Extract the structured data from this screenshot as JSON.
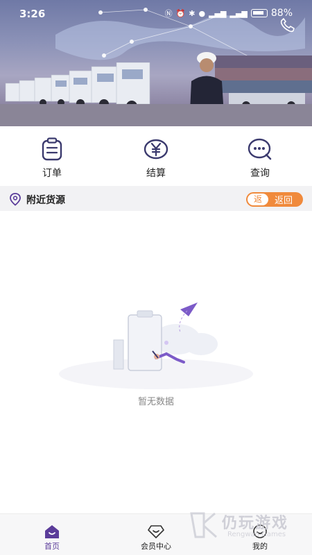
{
  "status_bar": {
    "time": "3:26",
    "battery": "88%"
  },
  "menu": [
    {
      "label": "订单",
      "icon": "clipboard-icon"
    },
    {
      "label": "结算",
      "icon": "yen-icon"
    },
    {
      "label": "查询",
      "icon": "chat-search-icon"
    }
  ],
  "section": {
    "title": "附近货源",
    "return_chip": "返",
    "return_label": "返回"
  },
  "empty_state": {
    "text": "暂无数据"
  },
  "bottom_nav": [
    {
      "label": "首页",
      "icon": "home-icon",
      "active": true
    },
    {
      "label": "会员中心",
      "icon": "diamond-icon",
      "active": false
    },
    {
      "label": "我的",
      "icon": "smile-icon",
      "active": false
    }
  ],
  "watermark": {
    "text": "仍玩游戏",
    "sub": "Rengwan Games"
  },
  "colors": {
    "accent": "#5b3c9a",
    "orange": "#f08a3c",
    "section_bg": "#f2f2f4"
  }
}
